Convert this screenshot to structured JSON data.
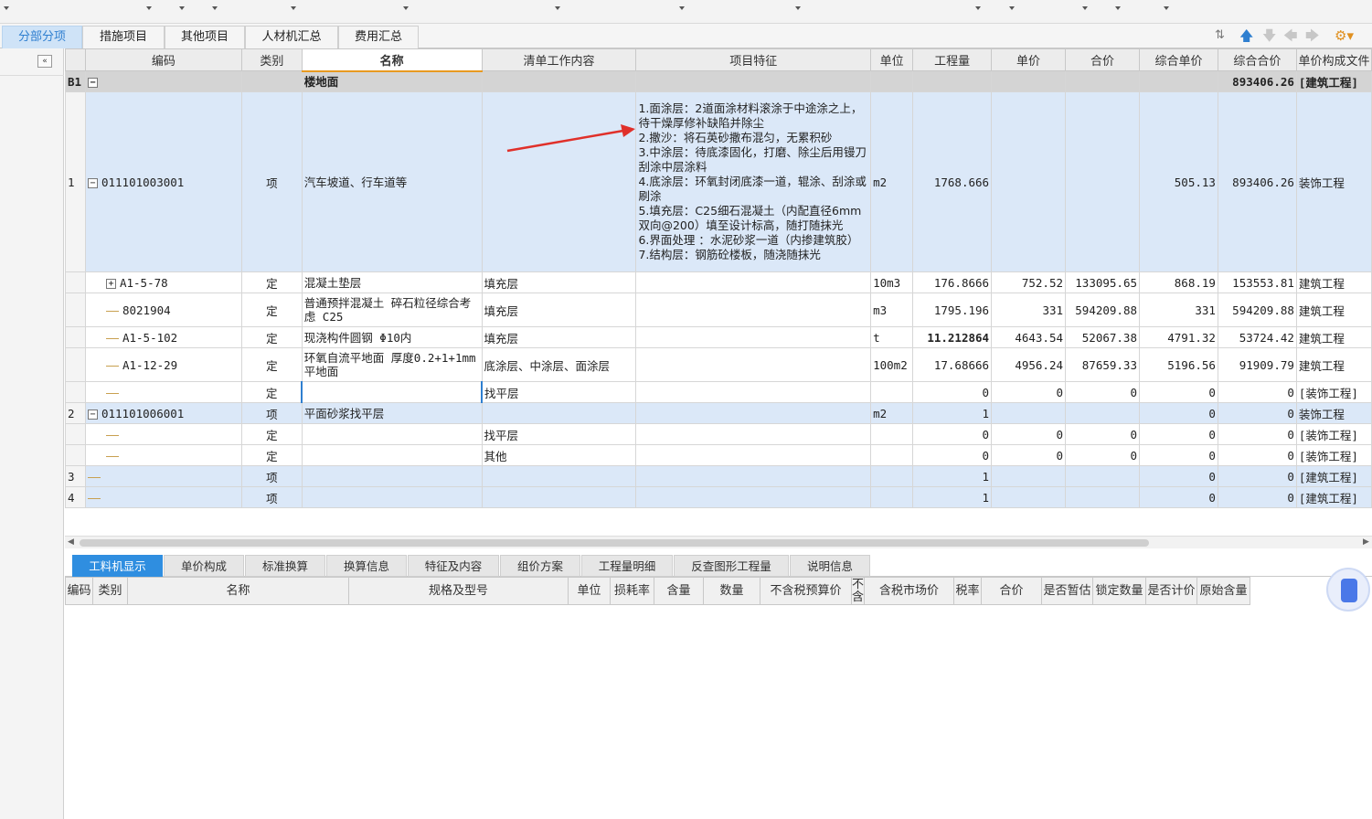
{
  "tabs": [
    "分部分项",
    "措施项目",
    "其他项目",
    "人材机汇总",
    "费用汇总"
  ],
  "active_tab": 0,
  "toolbar_icons": [
    "sort-icon",
    "move-up-icon",
    "move-down-icon",
    "move-left-icon",
    "move-right-icon",
    "settings-icon"
  ],
  "grid": {
    "headers": [
      "",
      "编码",
      "类别",
      "名称",
      "清单工作内容",
      "项目特征",
      "单位",
      "工程量",
      "单价",
      "合价",
      "综合单价",
      "综合合价",
      "单价构成文件"
    ],
    "rows": [
      {
        "kind": "b1",
        "idx": "B1",
        "code": "",
        "type": "",
        "name": "楼地面",
        "work": "",
        "feature": "",
        "unit": "",
        "qty": "",
        "price": "",
        "total": "",
        "cprice": "",
        "ctotal": "893406.26",
        "file": "[建筑工程]"
      },
      {
        "kind": "xiang",
        "idx": "1",
        "code": "011101003001",
        "type": "项",
        "name": "汽车坡道、行车道等",
        "work": "",
        "feature": [
          "1.面涂层：2道面涂材料滚涂于中途涂之上，待干燥厚修补缺陷并除尘",
          "2.撒沙：将石英砂撒布混匀，无累积砂",
          "3.中涂层：待底漆固化，打磨、除尘后用镘刀刮涂中层涂料",
          "4.底涂层：环氧封闭底漆一道，辊涂、刮涂或刷涂",
          "5.填充层：C25细石混凝土（内配直径6mm双向@200）填至设计标高，随打随抹光",
          "6.界面处理 ：水泥砂浆一道（内掺建筑胶）",
          "7.结构层：钢筋砼楼板，随浇随抹光"
        ],
        "unit": "m2",
        "qty": "1768.666",
        "price": "",
        "total": "",
        "cprice": "505.13",
        "ctotal": "893406.26",
        "file": "装饰工程"
      },
      {
        "kind": "ding",
        "idx": "",
        "code": "A1-5-78",
        "type": "定",
        "name": "混凝土垫层",
        "work": "填充层",
        "feature": "",
        "unit": "10m3",
        "qty": "176.8666",
        "price": "752.52",
        "total": "133095.65",
        "cprice": "868.19",
        "ctotal": "153553.81",
        "file": "建筑工程"
      },
      {
        "kind": "ding",
        "idx": "",
        "code": "8021904",
        "type": "定",
        "name": "普通预拌混凝土 碎石粒径综合考虑 C25",
        "work": "填充层",
        "feature": "",
        "unit": "m3",
        "qty": "1795.196",
        "price": "331",
        "total": "594209.88",
        "cprice": "331",
        "ctotal": "594209.88",
        "file": "建筑工程"
      },
      {
        "kind": "ding",
        "idx": "",
        "code": "A1-5-102",
        "type": "定",
        "name": "现浇构件圆钢 Φ10内",
        "work": "填充层",
        "feature": "",
        "unit": "t",
        "qty": "11.212864",
        "price": "4643.54",
        "total": "52067.38",
        "cprice": "4791.32",
        "ctotal": "53724.42",
        "file": "建筑工程"
      },
      {
        "kind": "ding",
        "idx": "",
        "code": "A1-12-29",
        "type": "定",
        "name": "环氧自流平地面 厚度0.2+1+1mm 平地面",
        "work": "底涂层、中涂层、面涂层",
        "feature": "",
        "unit": "100m2",
        "qty": "17.68666",
        "price": "4956.24",
        "total": "87659.33",
        "cprice": "5196.56",
        "ctotal": "91909.79",
        "file": "建筑工程"
      },
      {
        "kind": "cur",
        "idx": "",
        "code": "",
        "type": "定",
        "name": "",
        "work": "找平层",
        "feature": "",
        "unit": "",
        "qty": "0",
        "price": "0",
        "total": "0",
        "cprice": "0",
        "ctotal": "0",
        "file": "[装饰工程]"
      },
      {
        "kind": "xiang",
        "idx": "2",
        "code": "011101006001",
        "type": "项",
        "name": "平面砂浆找平层",
        "work": "",
        "feature": "",
        "unit": "m2",
        "qty": "1",
        "price": "",
        "total": "",
        "cprice": "0",
        "ctotal": "0",
        "file": "装饰工程"
      },
      {
        "kind": "ding",
        "idx": "",
        "code": "",
        "type": "定",
        "name": "",
        "work": "找平层",
        "feature": "",
        "unit": "",
        "qty": "0",
        "price": "0",
        "total": "0",
        "cprice": "0",
        "ctotal": "0",
        "file": "[装饰工程]"
      },
      {
        "kind": "ding",
        "idx": "",
        "code": "",
        "type": "定",
        "name": "",
        "work": "其他",
        "feature": "",
        "unit": "",
        "qty": "0",
        "price": "0",
        "total": "0",
        "cprice": "0",
        "ctotal": "0",
        "file": "[装饰工程]"
      },
      {
        "kind": "xiang",
        "idx": "3",
        "code": "",
        "type": "项",
        "name": "",
        "work": "",
        "feature": "",
        "unit": "",
        "qty": "1",
        "price": "",
        "total": "",
        "cprice": "0",
        "ctotal": "0",
        "file": "[建筑工程]"
      },
      {
        "kind": "xiang",
        "idx": "4",
        "code": "",
        "type": "项",
        "name": "",
        "work": "",
        "feature": "",
        "unit": "",
        "qty": "1",
        "price": "",
        "total": "",
        "cprice": "0",
        "ctotal": "0",
        "file": "[建筑工程]"
      }
    ]
  },
  "bottom_tabs": [
    "工料机显示",
    "单价构成",
    "标准换算",
    "换算信息",
    "特征及内容",
    "组价方案",
    "工程量明细",
    "反查图形工程量",
    "说明信息"
  ],
  "bottom_active": 0,
  "bottom_headers": [
    "编码",
    "类别",
    "名称",
    "规格及型号",
    "单位",
    "损耗率",
    "含量",
    "数量",
    "不含税预算价",
    "不含",
    "含税市场价",
    "税率",
    "合价",
    "是否暂估",
    "锁定数量",
    "是否计价",
    "原始含量"
  ],
  "colors": {
    "accent": "#2f7fd0",
    "row_highlight": "#dbe8f8",
    "arrow": "#e0302a"
  }
}
